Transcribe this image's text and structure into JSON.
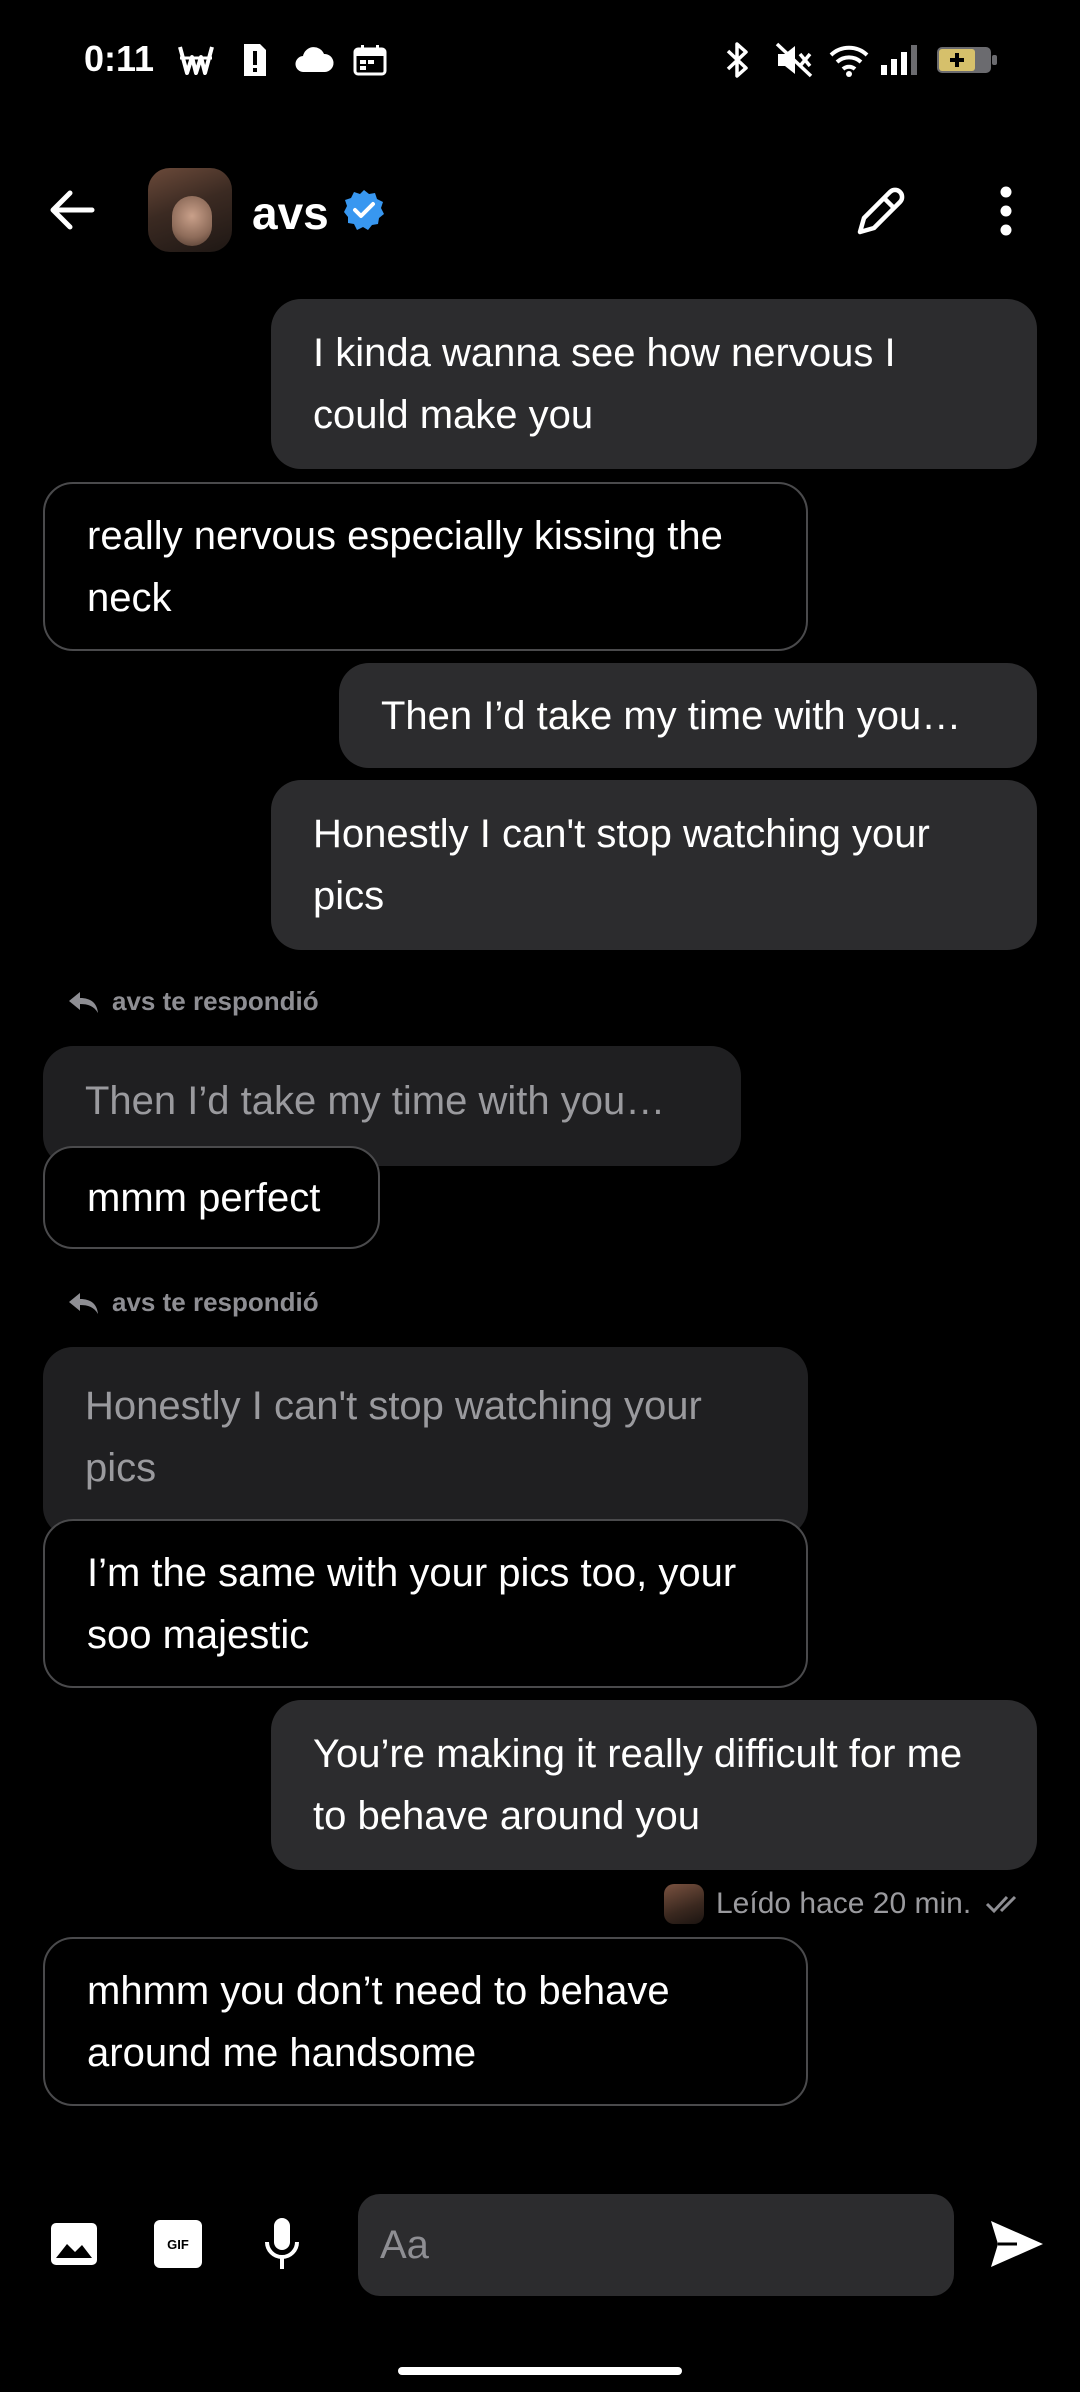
{
  "status_bar": {
    "time": "0:11",
    "left_icons": [
      "w-currency-icon",
      "sim-alert-icon",
      "cloud-icon",
      "calendar-icon"
    ],
    "right_icons": [
      "bluetooth-icon",
      "mute-icon",
      "wifi-icon",
      "signal-icon",
      "battery-icon"
    ]
  },
  "header": {
    "contact_name": "avs",
    "verified": true,
    "accent_color": "#3897f0"
  },
  "messages": [
    {
      "side": "out",
      "text": "I kinda wanna see how nervous I could make you"
    },
    {
      "side": "in",
      "text": "really nervous especially kissing the neck"
    },
    {
      "side": "out",
      "text": "Then I’d take my time with you…"
    },
    {
      "side": "out",
      "text": "Honestly I can't stop watching your pics"
    },
    {
      "side": "in",
      "reply_label": "avs te respondió",
      "quoted": "Then I’d take my time with you…",
      "text": "mmm perfect"
    },
    {
      "side": "in",
      "reply_label": "avs te respondió",
      "quoted": "Honestly I can't stop watching your pics",
      "text": "I’m the same with your pics too, your soo majestic"
    },
    {
      "side": "out",
      "text": "You’re making it really difficult for me to behave around you"
    },
    {
      "side": "in",
      "text": "mhmm you don’t need to behave around me handsome"
    }
  ],
  "read_receipt": "Leído hace 20 min.",
  "composer": {
    "placeholder": "Aa",
    "gif_label": "GIF"
  },
  "colors": {
    "background": "#000000",
    "outgoing_bubble": "#2c2c2e",
    "incoming_border": "#4a4a4c",
    "quoted_bubble": "#1f1f21"
  }
}
